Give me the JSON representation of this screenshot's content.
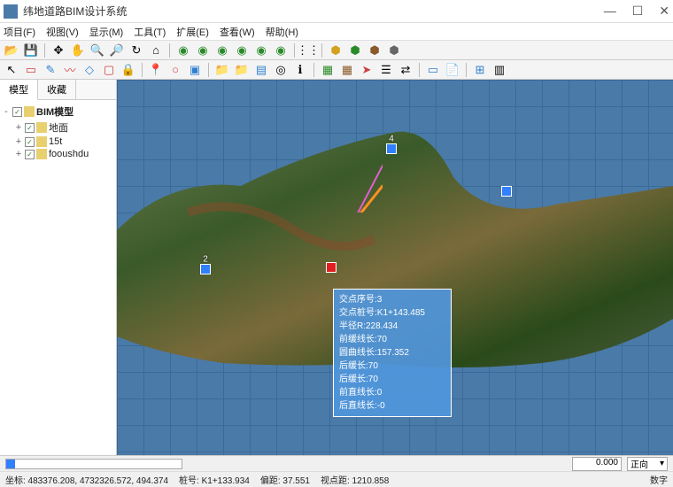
{
  "app": {
    "title": "纬地道路BIM设计系统"
  },
  "menu": [
    "项目(F)",
    "视图(V)",
    "显示(M)",
    "工具(T)",
    "扩展(E)",
    "查看(W)",
    "帮助(H)"
  ],
  "sidebar": {
    "tabs": [
      "模型",
      "收藏"
    ],
    "root": "BIM模型",
    "items": [
      "地面",
      "15t",
      "fooushdu"
    ]
  },
  "markers": {
    "m2": "2",
    "m4": "4"
  },
  "info": {
    "l1": "交点序号:3",
    "l2": "交点桩号:K1+143.485",
    "l3": "半径R:228.434",
    "l4": "前缓线长:70",
    "l5": "圆曲线长:157.352",
    "l6": "后缓长:70",
    "l7": "后缓长:70",
    "l8": "前直线长:0",
    "l9": "后直线长:-0"
  },
  "bottom": {
    "value": "0.000",
    "direction": "正向"
  },
  "status": {
    "coord": "坐标: 483376.208, 4732326.572, 494.374",
    "stake": "桩号: K1+133.934",
    "offset": "偏距: 37.551",
    "viewdist": "视点距: 1210.858",
    "digits": "数字"
  }
}
